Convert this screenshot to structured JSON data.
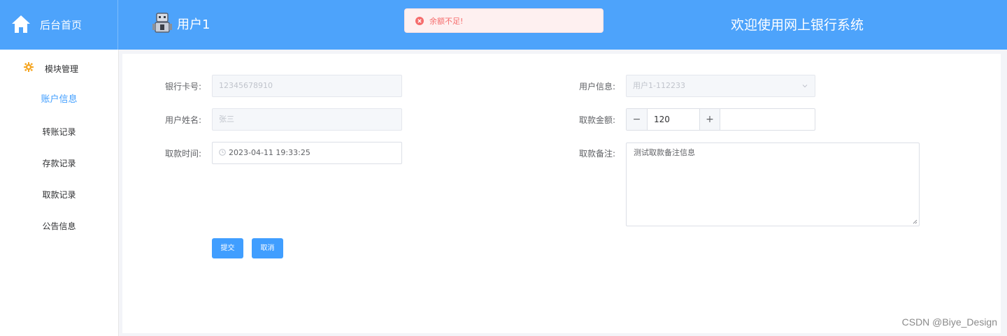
{
  "header": {
    "logo_text": "后台首页",
    "user_name": "用户1",
    "welcome": "欢迎使用网上银行系统"
  },
  "toast": {
    "message": "余额不足!",
    "icon": "error-circle-icon"
  },
  "sidebar": {
    "group_label": "模块管理",
    "group_icon": "gear-icon",
    "items": [
      {
        "label": "账户信息",
        "active": true
      },
      {
        "label": "转账记录"
      },
      {
        "label": "存款记录"
      },
      {
        "label": "取款记录"
      },
      {
        "label": "公告信息"
      }
    ]
  },
  "form": {
    "card_label": "银行卡号:",
    "card_value": "12345678910",
    "name_label": "用户姓名:",
    "name_value": "张三",
    "time_label": "取款时间:",
    "time_value": "2023-04-11 19:33:25",
    "user_label": "用户信息:",
    "user_value": "用户1-112233",
    "amount_label": "取款金额:",
    "amount_value": "120",
    "amount_minus": "−",
    "amount_plus": "+",
    "remark_label": "取款备注:",
    "remark_value": "测试取款备注信息",
    "submit": "提交",
    "cancel": "取消"
  },
  "watermark": "CSDN @Biye_Design",
  "colors": {
    "primary": "#409eff",
    "header": "#4da3fb",
    "error": "#f56c6c"
  }
}
